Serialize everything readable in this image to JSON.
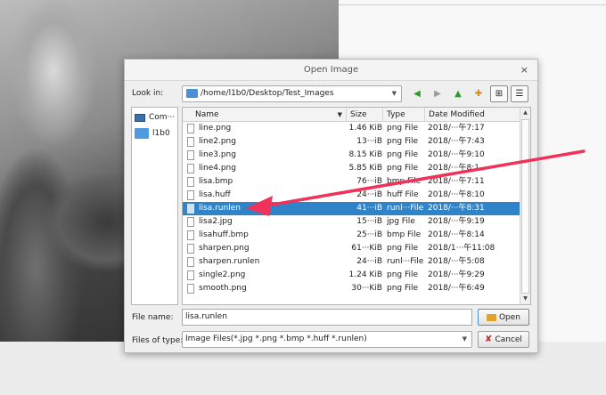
{
  "colors": {
    "selection": "#2f83c8",
    "annotation_arrow": "#f0325a",
    "folder": "#4f9be0"
  },
  "dialog": {
    "title": "Open Image",
    "close_glyph": "×",
    "look_in_label": "Look in:",
    "path": "/home/l1b0/Desktop/Test_Images",
    "toolbar": {
      "back": "◀",
      "forward": "▶",
      "up": "▲",
      "new_folder": "✚",
      "list_view": "⊞",
      "detail_view": "☰"
    },
    "sidebar": [
      {
        "label": "Com···",
        "icon": "computer-icon"
      },
      {
        "label": "l1b0",
        "icon": "folder-icon"
      }
    ],
    "columns": {
      "name": "Name",
      "size": "Size",
      "type": "Type",
      "date": "Date Modified"
    },
    "files": [
      {
        "name": "line.png",
        "size": "1.46 KiB",
        "type": "png File",
        "date": "2018/···午7:17",
        "selected": false
      },
      {
        "name": "line2.png",
        "size": "13···iB",
        "type": "png File",
        "date": "2018/···午7:43",
        "selected": false
      },
      {
        "name": "line3.png",
        "size": "8.15 KiB",
        "type": "png File",
        "date": "2018/···午9:10",
        "selected": false
      },
      {
        "name": "line4.png",
        "size": "5.85 KiB",
        "type": "png File",
        "date": "2018/···午8:1",
        "selected": false
      },
      {
        "name": "lisa.bmp",
        "size": "76···iB",
        "type": "bmp File",
        "date": "2018/···午7:11",
        "selected": false
      },
      {
        "name": "lisa.huff",
        "size": "24···iB",
        "type": "huff File",
        "date": "2018/···午8:10",
        "selected": false
      },
      {
        "name": "lisa.runlen",
        "size": "41···iB",
        "type": "runl···File",
        "date": "2018/···午8:31",
        "selected": true
      },
      {
        "name": "lisa2.jpg",
        "size": "15···iB",
        "type": "jpg File",
        "date": "2018/···午9:19",
        "selected": false
      },
      {
        "name": "lisahuff.bmp",
        "size": "25···iB",
        "type": "bmp File",
        "date": "2018/···午8:14",
        "selected": false
      },
      {
        "name": "sharpen.png",
        "size": "61···KiB",
        "type": "png File",
        "date": "2018/1···午11:08",
        "selected": false
      },
      {
        "name": "sharpen.runlen",
        "size": "24···iB",
        "type": "runl···File",
        "date": "2018/···午5:08",
        "selected": false
      },
      {
        "name": "single2.png",
        "size": "1.24 KiB",
        "type": "png File",
        "date": "2018/···午9:29",
        "selected": false
      },
      {
        "name": "smooth.png",
        "size": "30···KiB",
        "type": "png File",
        "date": "2018/···午6:49",
        "selected": false
      }
    ],
    "file_name_label": "File name:",
    "file_name_value": "lisa.runlen",
    "open_label": "Open",
    "files_of_type_label": "Files of type:",
    "files_of_type_value": "Image Files(*.jpg *.png *.bmp *.huff *.runlen)",
    "cancel_label": "Cancel"
  }
}
